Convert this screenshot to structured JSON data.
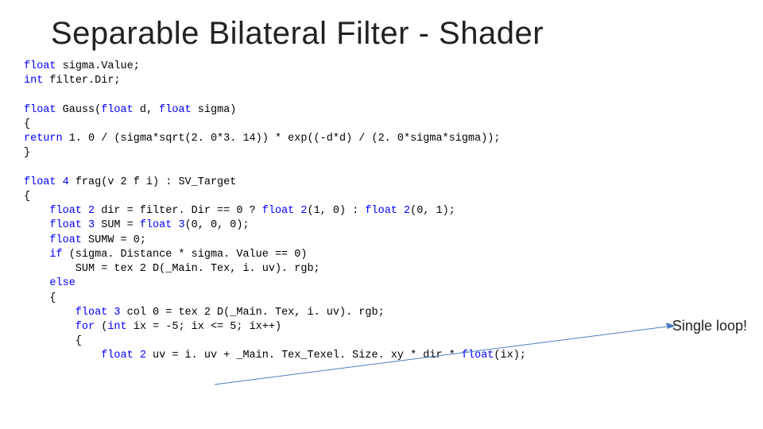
{
  "title": "Separable Bilateral Filter - Shader",
  "code": {
    "l1a": "float",
    "l1b": " sigma.Value;",
    "l2a": "int",
    "l2b": " filter.Dir;",
    "l4a": "float",
    "l4b": " Gauss(",
    "l4c": "float",
    "l4d": " d, ",
    "l4e": "float",
    "l4f": " sigma)",
    "l5": "{",
    "l6a": "return",
    "l6b": " 1. 0 / (sigma*sqrt(2. 0*3. 14)) * exp((-d*d) / (2. 0*sigma*sigma));",
    "l7": "}",
    "l9a": "float 4",
    "l9b": " frag(v 2 f i) : SV_Target",
    "l10": "{",
    "l11a": "    float 2",
    "l11b": " dir = filter. Dir == 0 ? ",
    "l11c": "float 2",
    "l11d": "(1, 0) : ",
    "l11e": "float 2",
    "l11f": "(0, 1);",
    "l12a": "    float 3",
    "l12b": " SUM = ",
    "l12c": "float 3",
    "l12d": "(0, 0, 0);",
    "l13a": "    float",
    "l13b": " SUMW = 0;",
    "l14a": "    if",
    "l14b": " (sigma. Distance * sigma. Value == 0)",
    "l15": "        SUM = tex 2 D(_Main. Tex, i. uv). rgb;",
    "l16a": "    else",
    "l17": "    {",
    "l18a": "        float 3",
    "l18b": " col 0 = tex 2 D(_Main. Tex, i. uv). rgb;",
    "l19a": "        for",
    "l19b": " (",
    "l19c": "int",
    "l19d": " ix = -5; ix <= 5; ix++)",
    "l20": "        {",
    "l21a": "            float 2",
    "l21b": " uv = i. uv + _Main. Tex_Texel. Size. xy * dir * ",
    "l21c": "float",
    "l21d": "(ix);"
  },
  "callout": "Single loop!",
  "arrow_color": "#4a7fbf"
}
